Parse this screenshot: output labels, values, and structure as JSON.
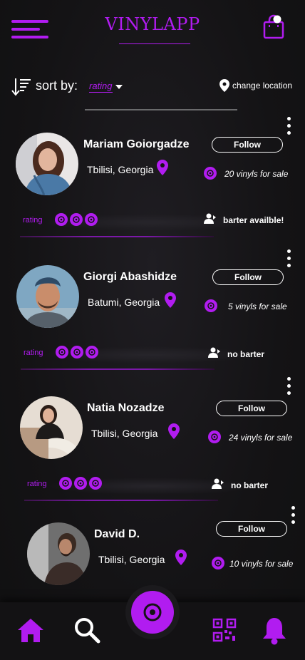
{
  "header": {
    "title": "VINYLAPP",
    "menu_icon": "hamburger-icon",
    "cart_icon": "shopping-bag-icon",
    "cart_badge": "notification-dot"
  },
  "sort": {
    "label": "sort by:",
    "value": "rating",
    "change_location": "change location"
  },
  "colors": {
    "accent": "#b11cf0",
    "background": "#141315",
    "text": "#ffffff"
  },
  "users": [
    {
      "name": "Mariam Goiorgadze",
      "location": "Tbilisi, Georgia",
      "follow": "Follow",
      "vinyls": "20 vinyls for sale",
      "rating_label": "rating",
      "rating": 3,
      "barter": "barter availble!"
    },
    {
      "name": "Giorgi  Abashidze",
      "location": "Batumi, Georgia",
      "follow": "Follow",
      "vinyls": "5 vinyls for sale",
      "rating_label": "rating",
      "rating": 3,
      "barter": "no barter"
    },
    {
      "name": "Natia Nozadze",
      "location": "Tbilisi, Georgia",
      "follow": "Follow",
      "vinyls": "24 vinyls for sale",
      "rating_label": "rating",
      "rating": 3,
      "barter": "no barter"
    },
    {
      "name": "David D.",
      "location": "Tbilisi, Georgia",
      "follow": "Follow",
      "vinyls": "10 vinyls for sale"
    }
  ],
  "nav": {
    "items": [
      "home-icon",
      "search-icon",
      "vinyl-record-icon",
      "qr-code-icon",
      "bell-icon"
    ]
  }
}
